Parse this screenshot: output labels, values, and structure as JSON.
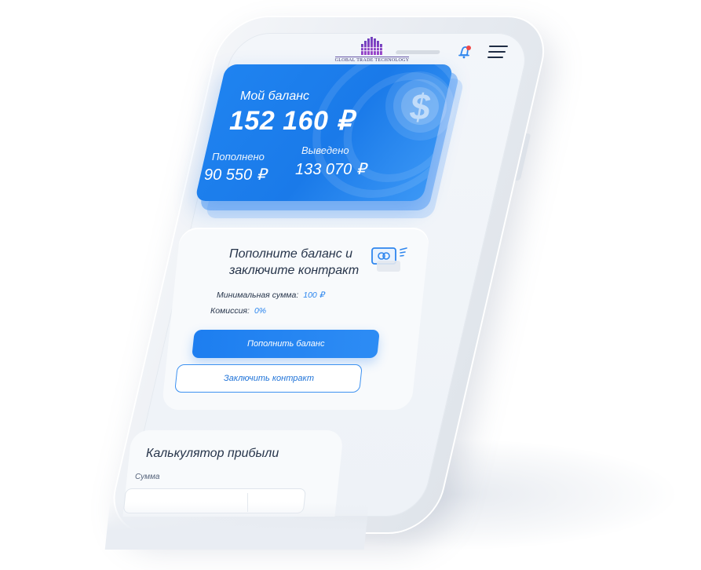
{
  "header": {
    "logo_text": "GLOBAL TRADE TECHNOLOGY",
    "bell_icon": "bell-icon",
    "menu_icon": "hamburger-menu-icon",
    "notification_color": "#f04848"
  },
  "balance_card": {
    "label": "Мой баланс",
    "value": "152 160 ₽",
    "deposited_label": "Пополнено",
    "deposited_value": "90 550 ₽",
    "withdrawn_label": "Выведено",
    "withdrawn_value": "133 070 ₽",
    "coin_icon": "dollar-coin-icon",
    "accent_color": "#1f83f0"
  },
  "deposit_panel": {
    "title_line1": "Пополните баланс и",
    "title_line2": "заключите контракт",
    "card_icon": "credit-card-icon",
    "min_amount_label": "Минимальная сумма:",
    "min_amount_value": "100 ₽",
    "fee_label": "Комиссия:",
    "fee_value": "0%",
    "deposit_button": "Пополнить баланс",
    "contract_button": "Заключить контракт"
  },
  "calculator": {
    "title": "Калькулятор прибыли",
    "amount_label": "Сумма"
  }
}
